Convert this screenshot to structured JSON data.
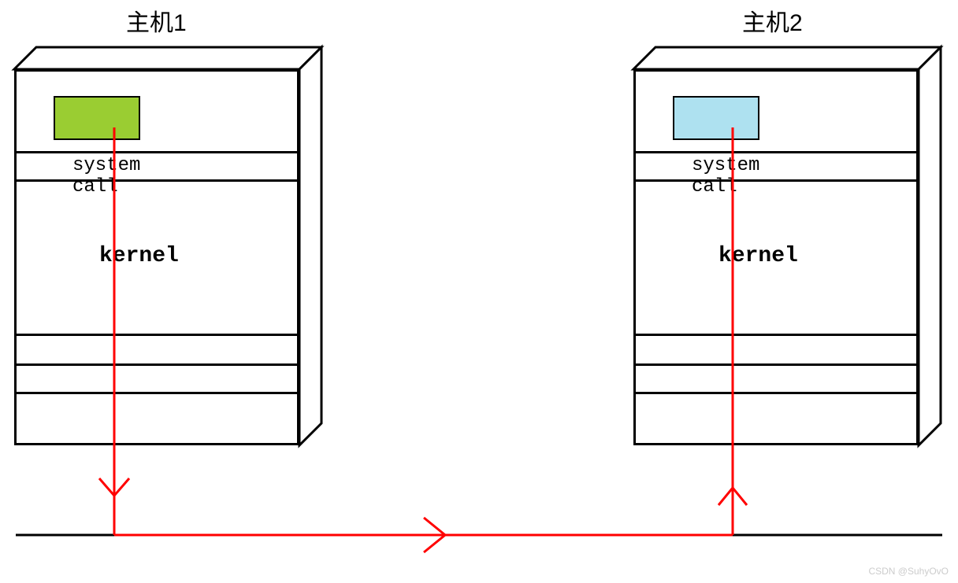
{
  "host1": {
    "title": "主机1",
    "syscall_label": "system call",
    "kernel_label": "kernel",
    "app_color": "#9acd32"
  },
  "host2": {
    "title": "主机2",
    "syscall_label": "system call",
    "kernel_label": "kernel",
    "app_color": "#aee1f0"
  },
  "arrow_color": "#ff0000",
  "watermark": "CSDN @SuhyOvO"
}
